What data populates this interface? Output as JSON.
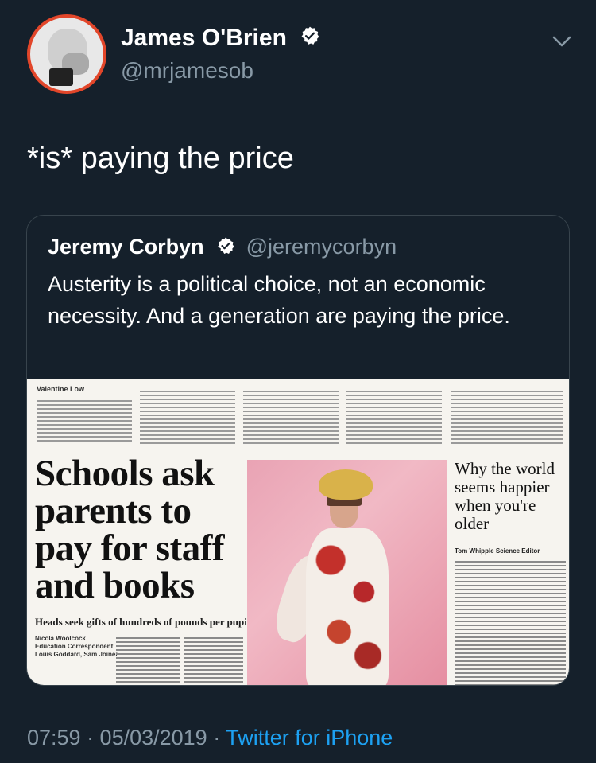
{
  "author": {
    "name": "James O'Brien",
    "handle": "@mrjamesob"
  },
  "tweet": {
    "text": "*is* paying the price",
    "timestamp": "07:59 · 05/03/2019 · ",
    "client": "Twitter for iPhone"
  },
  "quoted": {
    "name": "Jeremy Corbyn",
    "handle": "@jeremycorbyn",
    "text": "Austerity is a political choice, not an economic necessity. And a generation are paying the price."
  },
  "newspaper": {
    "top_byline": "Valentine Low",
    "headline": "Schools ask parents to pay for staff and books",
    "subhead": "Heads seek gifts of hundreds of pounds per pupil",
    "authors": "Nicola Woolcock\nEducation Correspondent\nLouis Goddard, Sam Joiner",
    "side_headline": "Why the world seems happier when you're older",
    "side_byline": "Tom Whipple Science Editor"
  },
  "colors": {
    "background": "#15202b",
    "accent": "#1da1f2",
    "muted": "#8899a6",
    "border": "#38444d"
  },
  "icons": {
    "verified": "verified-badge-icon",
    "chevron": "chevron-down-icon"
  }
}
